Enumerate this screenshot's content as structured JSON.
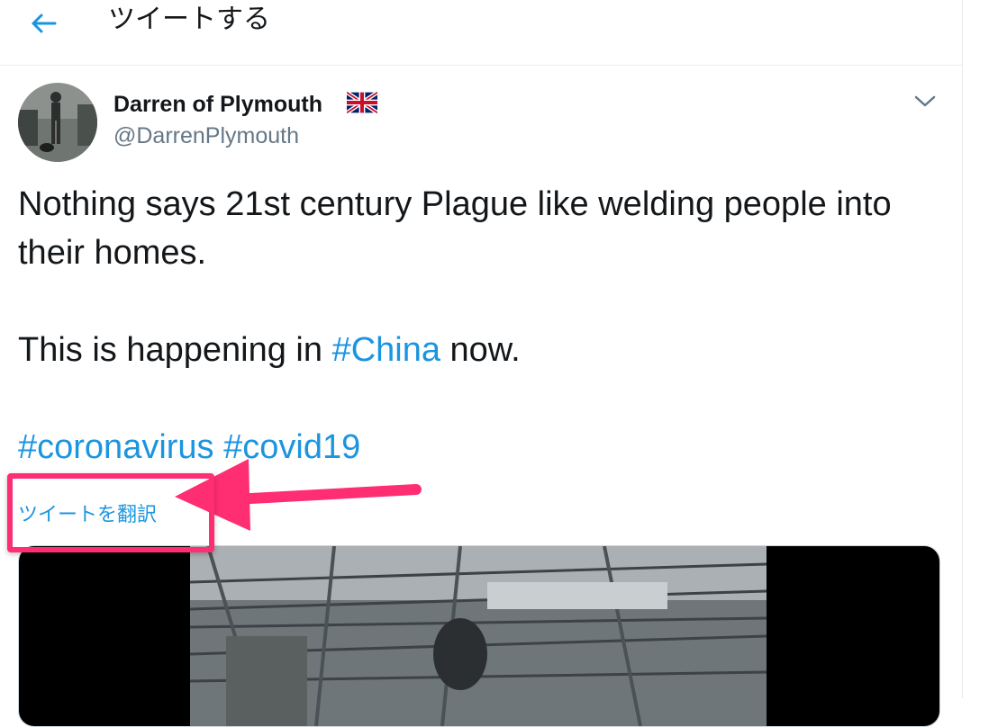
{
  "header": {
    "title": "ツイートする",
    "back_icon": "arrow-left-icon"
  },
  "tweet": {
    "user_name": "Darren of Plymouth",
    "flag_icon": "uk-flag-icon",
    "handle": "@DarrenPlymouth",
    "line1": "Nothing says 21st century Plague like welding people into their homes.",
    "line2_before": "This is happening in ",
    "line2_hashtag": "#China",
    "line2_after": " now.",
    "hashtag1": "#coronavirus",
    "hashtag2": "#covid19",
    "translate_label": "ツイートを翻訳"
  },
  "colors": {
    "link": "#1b95e0",
    "annotation": "#ff2d72",
    "border": "#e6ecf0"
  }
}
